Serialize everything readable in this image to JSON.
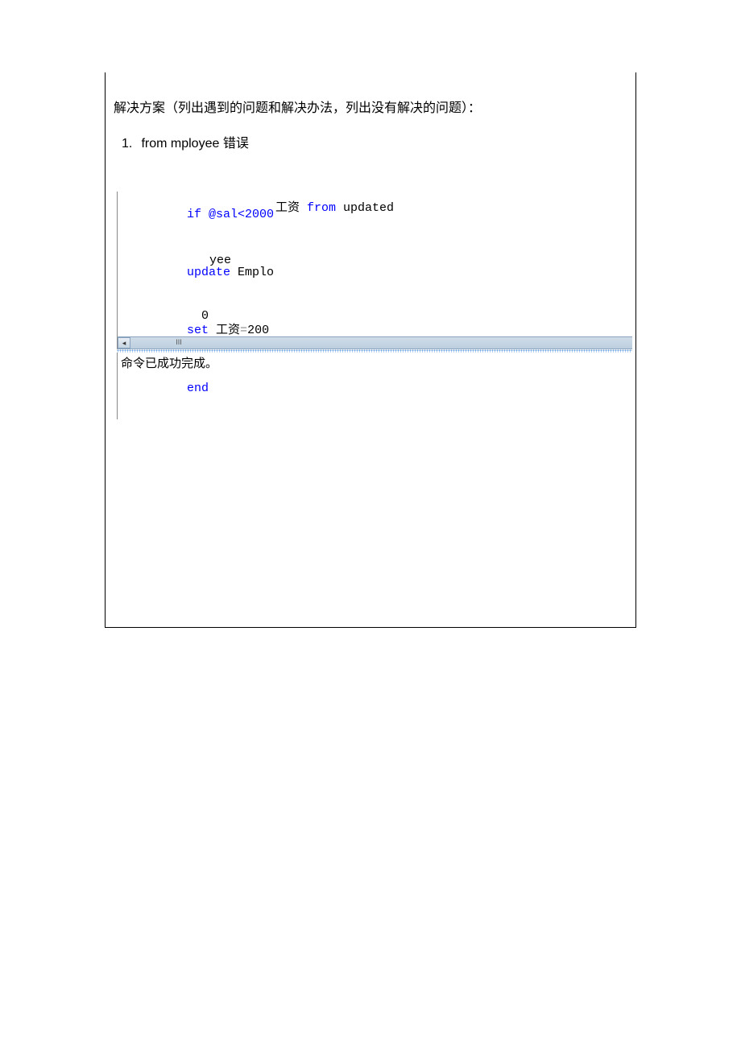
{
  "document": {
    "section_title": "解决方案（列出遇到的问题和解决办法，列出没有解决的问题）：",
    "list": {
      "number": "1.",
      "text": "from mployee 错误"
    }
  },
  "code": {
    "line1_left": "if @sal<2000",
    "line1_overlap": "工资 from updated",
    "line2_left": "update Emplo",
    "line2_overlap": "yee",
    "line3_left": "set 工资=200",
    "line3_overlap": "0",
    "line4": "end"
  },
  "scrollbar": {
    "left_arrow": "◂",
    "thumb": "III"
  },
  "result": {
    "message": "命令已成功完成。"
  }
}
